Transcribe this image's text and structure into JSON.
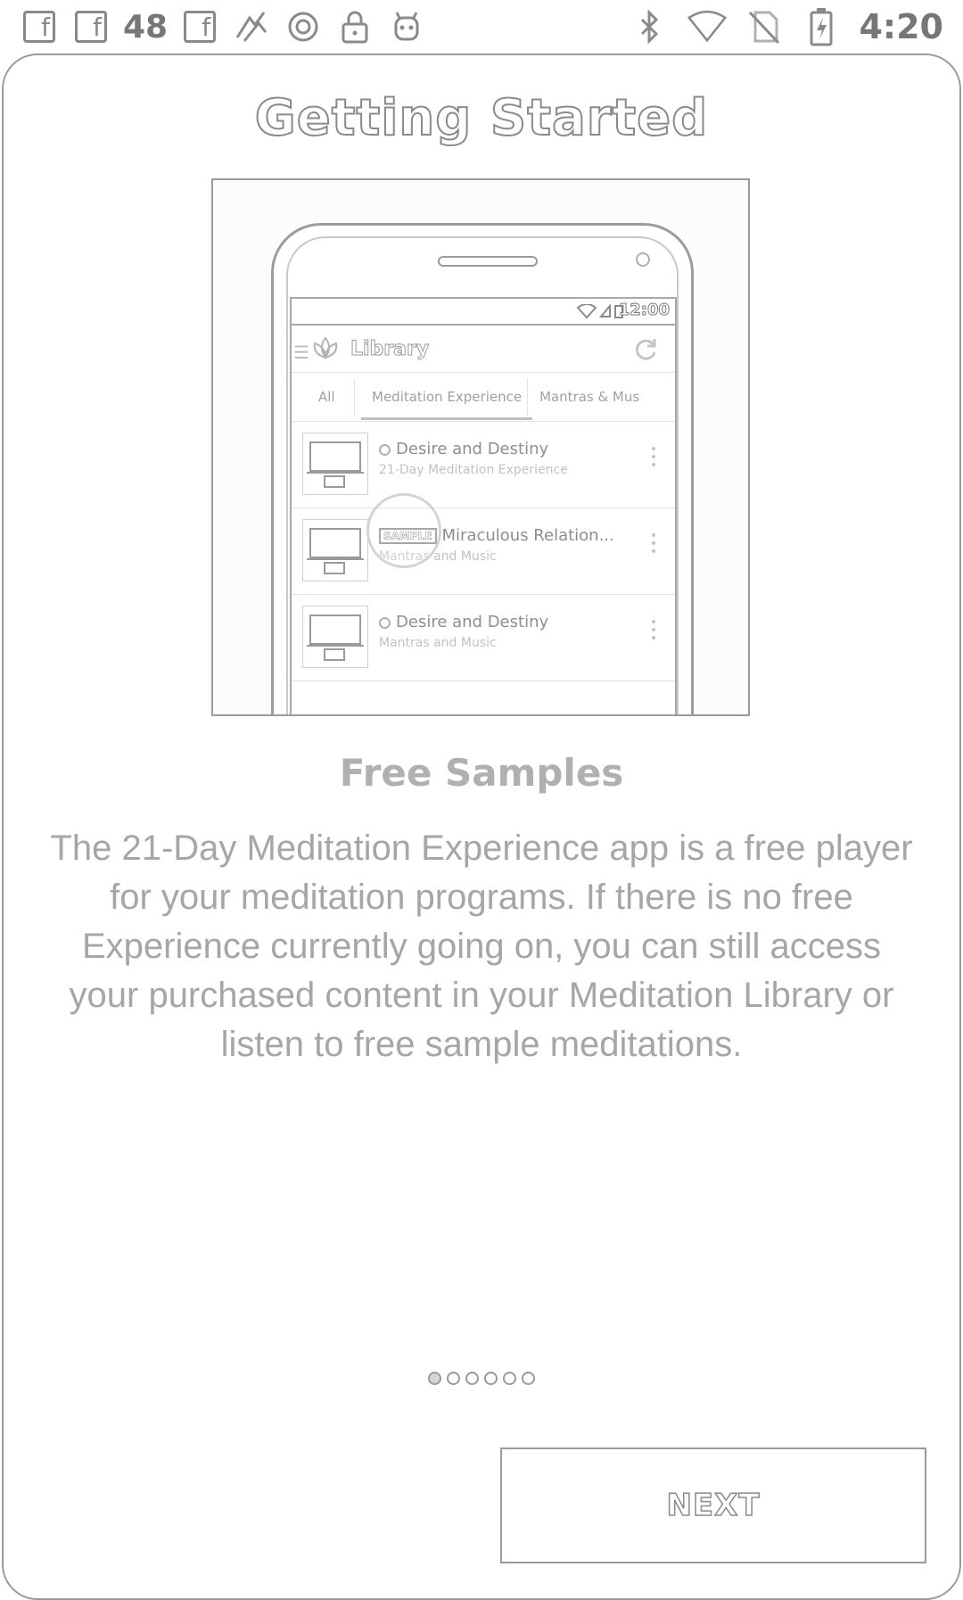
{
  "status_bar": {
    "notification_count": "48",
    "time": "4:20",
    "notification_icons": [
      "facebook-icon",
      "facebook-icon",
      "facebook-icon",
      "app-icon",
      "circle-icon",
      "lock-icon",
      "android-icon"
    ],
    "system_icons": [
      "bluetooth-icon",
      "wifi-icon",
      "no-sim-icon",
      "battery-charging-icon"
    ]
  },
  "header": {
    "title": "Getting Started"
  },
  "illustration": {
    "phone_status_time": "12:00",
    "app_title": "Library",
    "tabs": [
      "All",
      "Meditation Experience",
      "Mantras & Mus"
    ],
    "active_tab": "Meditation Experience",
    "items": [
      {
        "title": "Desire and Destiny",
        "subtitle": "21-Day Meditation Experience",
        "badge": ""
      },
      {
        "title": "Miraculous Relation...",
        "subtitle": "Mantras and Music",
        "badge": "SAMPLE"
      },
      {
        "title": "Desire and Destiny",
        "subtitle": "Mantras and Music",
        "badge": ""
      }
    ]
  },
  "slide": {
    "title": "Free Samples",
    "body": "The 21-Day Meditation Experience app is a free player for your meditation programs. If there is no free Experience currently going on, you can still access your purchased content in your Meditation Library or listen to free sample meditations."
  },
  "pager": {
    "total": 6,
    "current": 1
  },
  "buttons": {
    "next_label": "NEXT"
  },
  "colors": {
    "outline": "#9a9a9a",
    "text_muted": "#a6a6a6",
    "background": "#ffffff"
  }
}
